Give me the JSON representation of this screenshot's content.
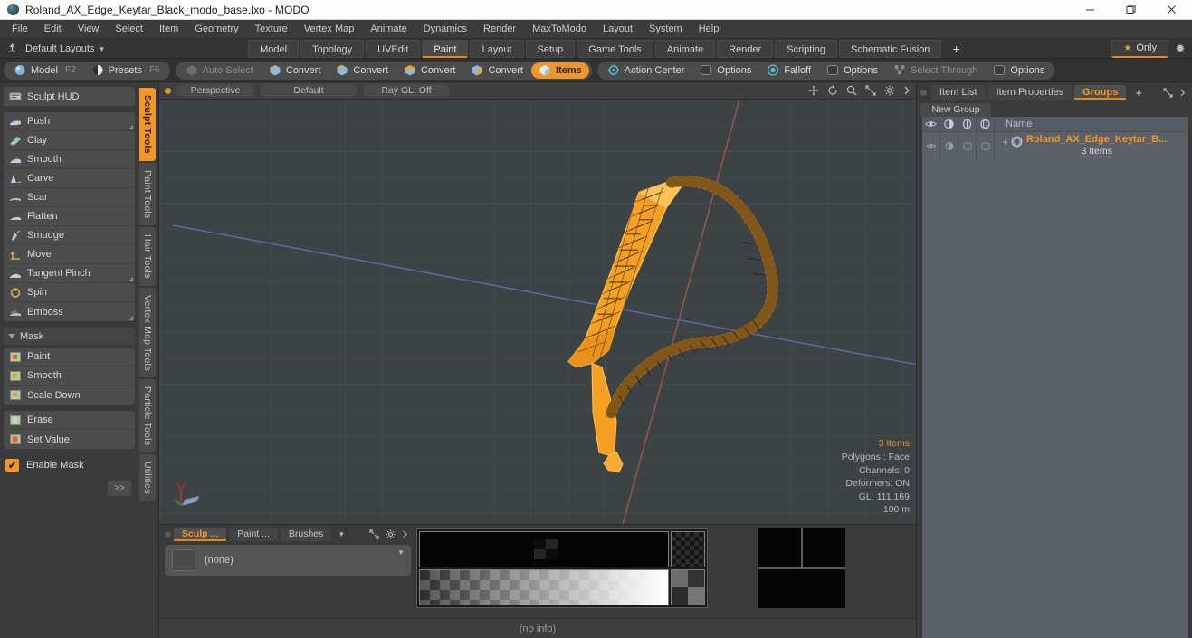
{
  "titlebar": {
    "title": "Roland_AX_Edge_Keytar_Black_modo_base.lxo - MODO",
    "minimize": "minimize-icon",
    "maximize": "maximize-icon",
    "close": "close-icon"
  },
  "menubar": {
    "items": [
      {
        "label": "File"
      },
      {
        "label": "Edit"
      },
      {
        "label": "View"
      },
      {
        "label": "Select"
      },
      {
        "label": "Item"
      },
      {
        "label": "Geometry"
      },
      {
        "label": "Texture"
      },
      {
        "label": "Vertex Map"
      },
      {
        "label": "Animate"
      },
      {
        "label": "Dynamics"
      },
      {
        "label": "Render"
      },
      {
        "label": "MaxToModo"
      },
      {
        "label": "Layout"
      },
      {
        "label": "System"
      },
      {
        "label": "Help"
      }
    ]
  },
  "layoutbar": {
    "anchor_icon": "anchor-icon",
    "layouts_label": "Default Layouts",
    "tabs": [
      {
        "label": "Model",
        "active": false
      },
      {
        "label": "Topology",
        "active": false
      },
      {
        "label": "UVEdit",
        "active": false
      },
      {
        "label": "Paint",
        "active": true
      },
      {
        "label": "Layout",
        "active": false
      },
      {
        "label": "Setup",
        "active": false
      },
      {
        "label": "Game Tools",
        "active": false
      },
      {
        "label": "Animate",
        "active": false
      },
      {
        "label": "Render",
        "active": false
      },
      {
        "label": "Scripting",
        "active": false
      },
      {
        "label": "Schematic Fusion",
        "active": false
      }
    ],
    "add_label": "+",
    "only_label": "Only",
    "gear_icon": "gear-icon",
    "accent": "#e08a12"
  },
  "modebar": {
    "group1": [
      {
        "label": "Model",
        "hotkey": "F2",
        "icon": "sphere-blue-icon",
        "state": "normal"
      },
      {
        "label": "Presets",
        "hotkey": "F6",
        "icon": "sphere-half-icon",
        "state": "normal"
      }
    ],
    "group2": [
      {
        "label": "Auto Select",
        "icon": "cube-grey-icon",
        "state": "dim"
      },
      {
        "label": "Convert",
        "icon": "cube-vertex-icon",
        "state": "normal"
      },
      {
        "label": "Convert",
        "icon": "cube-edge-icon",
        "state": "normal"
      },
      {
        "label": "Convert",
        "icon": "cube-poly-icon",
        "state": "normal"
      },
      {
        "label": "Convert",
        "icon": "cube-material-icon",
        "state": "normal"
      },
      {
        "label": "Items",
        "icon": "cube-items-icon",
        "state": "selected"
      }
    ],
    "group3": [
      {
        "label": "Action Center",
        "icon": "action-center-icon",
        "state": "normal"
      },
      {
        "label": "Options",
        "icon": "options-box-icon",
        "state": "normal"
      },
      {
        "label": "Falloff",
        "icon": "falloff-icon",
        "state": "normal"
      },
      {
        "label": "Options",
        "icon": "options-box-icon",
        "state": "normal"
      },
      {
        "label": "Select Through",
        "icon": "select-through-icon",
        "state": "dim"
      },
      {
        "label": "Options",
        "icon": "options-box-icon",
        "state": "normal"
      }
    ]
  },
  "leftpanel": {
    "hud_button": {
      "label": "Sculpt HUD",
      "icon": "hud-icon"
    },
    "sculpt_tools": [
      {
        "label": "Push",
        "icon": "brush-push-icon",
        "corner": true
      },
      {
        "label": "Clay",
        "icon": "brush-clay-icon",
        "corner": false
      },
      {
        "label": "Smooth",
        "icon": "brush-smooth-icon",
        "corner": false
      },
      {
        "label": "Carve",
        "icon": "brush-carve-icon",
        "corner": false
      },
      {
        "label": "Scar",
        "icon": "brush-scar-icon",
        "corner": false
      },
      {
        "label": "Flatten",
        "icon": "brush-flatten-icon",
        "corner": false
      },
      {
        "label": "Smudge",
        "icon": "brush-smudge-icon",
        "corner": false
      },
      {
        "label": "Move",
        "icon": "brush-move-icon",
        "corner": false
      },
      {
        "label": "Tangent Pinch",
        "icon": "brush-pinch-icon",
        "corner": true
      },
      {
        "label": "Spin",
        "icon": "brush-spin-icon",
        "corner": false
      },
      {
        "label": "Emboss",
        "icon": "brush-emboss-icon",
        "corner": true
      }
    ],
    "mask_header": "Mask",
    "mask_tools": [
      {
        "label": "Paint",
        "icon": "mask-paint-icon"
      },
      {
        "label": "Smooth",
        "icon": "mask-smooth-icon"
      },
      {
        "label": "Scale Down",
        "icon": "mask-scale-icon"
      }
    ],
    "mask_tools2": [
      {
        "label": "Erase",
        "icon": "mask-erase-icon"
      },
      {
        "label": "Set Value",
        "icon": "mask-setvalue-icon"
      }
    ],
    "enable_mask": {
      "label": "Enable Mask",
      "checked": true,
      "icon": "checkbox-icon"
    },
    "more_button": ">>",
    "vertical_tabs": [
      {
        "label": "Sculpt Tools",
        "active": true
      },
      {
        "label": "Paint Tools",
        "active": false
      },
      {
        "label": "Hair Tools",
        "active": false
      },
      {
        "label": "Vertex Map Tools",
        "active": false
      },
      {
        "label": "Particle Tools",
        "active": false
      },
      {
        "label": "Utilities",
        "active": false
      }
    ]
  },
  "viewport": {
    "header": {
      "view_label": "Perspective",
      "shading_label": "Default",
      "raygl_label": "Ray GL: Off",
      "icons": [
        "move-icon",
        "rotate-icon",
        "zoom-icon",
        "fit-icon",
        "gear-icon",
        "chevron-right-icon"
      ]
    },
    "info": {
      "items": "3 Items",
      "polygons": "Polygons : Face",
      "channels": "Channels: 0",
      "deformers": "Deformers: ON",
      "gl": "GL: 111,169",
      "scale": "100 m"
    },
    "axis_gizmo": "axis-gizmo-icon",
    "model_color": "#f59f20",
    "background_color": "#3d4245"
  },
  "bottomdock": {
    "tabs": [
      {
        "label": "Sculp ...",
        "active": true
      },
      {
        "label": "Paint ...",
        "active": false
      },
      {
        "label": "Brushes",
        "active": false
      }
    ],
    "tab_caret": "chevron-down-icon",
    "tool_icons": [
      "expand-icon",
      "gear-icon",
      "chevron-right-icon"
    ],
    "brush_field": {
      "value": "(none)",
      "swatch": "brush-swatch",
      "caret": "chevron-down-icon"
    },
    "status": "(no info)"
  },
  "rightpanel": {
    "tabs": [
      {
        "label": "Item List",
        "active": false
      },
      {
        "label": "Item Properties",
        "active": false
      },
      {
        "label": "Groups",
        "active": true
      }
    ],
    "add_label": "+",
    "tool_icons": [
      "expand-icon",
      "chevron-right-icon"
    ],
    "new_group_label": "New Group",
    "columns": [
      {
        "icon": "eye-icon"
      },
      {
        "icon": "render-icon"
      },
      {
        "icon": "shading-icon"
      },
      {
        "icon": "wireframe-icon"
      }
    ],
    "name_header": "Name",
    "rows": [
      {
        "expand": "+",
        "icon": "group-icon",
        "name": "Roland_AX_Edge_Keytar_B...",
        "subtitle": "3 Items"
      }
    ]
  }
}
